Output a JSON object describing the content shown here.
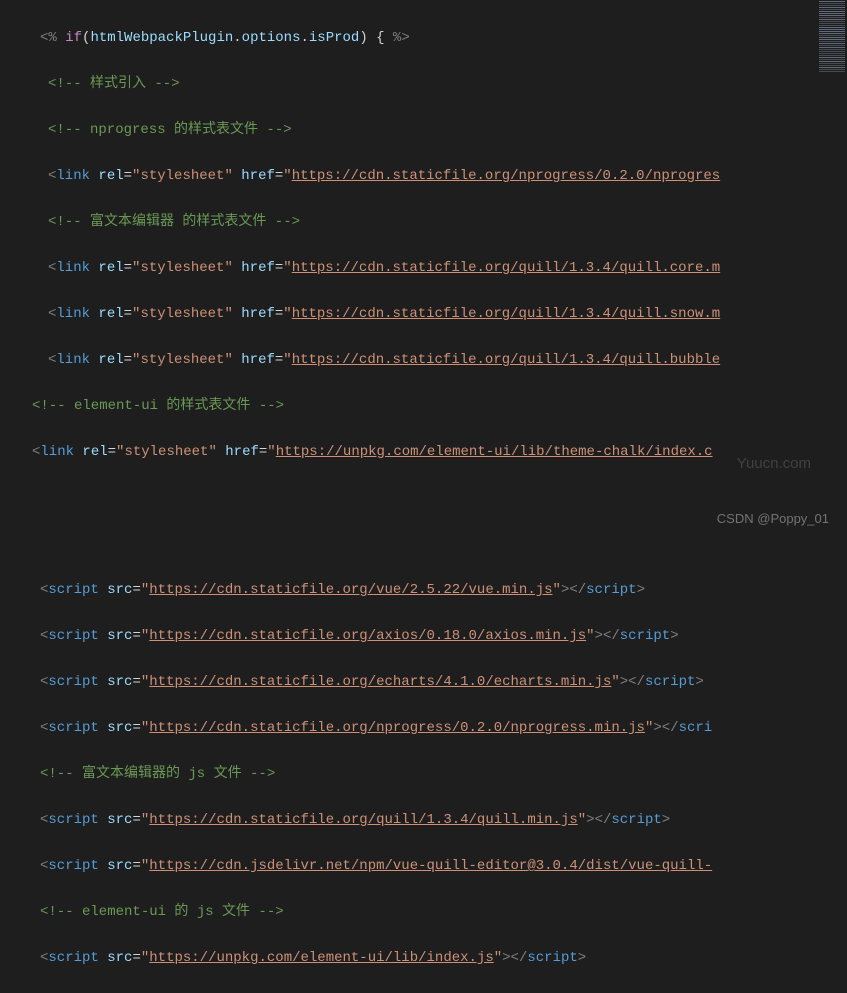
{
  "lines": {
    "l1a": "<%",
    "l1b": " if",
    "l1c": "(",
    "l1d": "htmlWebpackPlugin",
    "l1e": ".",
    "l1f": "options",
    "l1g": ".",
    "l1h": "isProd",
    "l1i": ") { ",
    "l1j": "%>",
    "c1": "<!-- 样式引入 -->",
    "c2": "<!-- nprogress 的样式表文件 -->",
    "rel": "rel",
    "href": "href",
    "src": "src",
    "eq": "=",
    "stylesheet": "\"stylesheet\"",
    "lt": "<",
    "gt": ">",
    "ltc": "</",
    "link": "link",
    "script": "script",
    "u1": "https://cdn.staticfile.org/nprogress/0.2.0/nprogres",
    "c3": "<!-- 富文本编辑器 的样式表文件 -->",
    "u2": "https://cdn.staticfile.org/quill/1.3.4/quill.core.m",
    "u3": "https://cdn.staticfile.org/quill/1.3.4/quill.snow.m",
    "u4": "https://cdn.staticfile.org/quill/1.3.4/quill.bubble",
    "c4": "<!-- element-ui 的样式表文件 -->",
    "u5": "https://unpkg.com/element-ui/lib/theme-chalk/index.c",
    "s1": "https://cdn.staticfile.org/vue/2.5.22/vue.min.js",
    "s2": "https://cdn.staticfile.org/axios/0.18.0/axios.min.js",
    "s3": "https://cdn.staticfile.org/echarts/4.1.0/echarts.min.js",
    "s4": "https://cdn.staticfile.org/nprogress/0.2.0/nprogress.min.js",
    "c5": "<!-- 富文本编辑器的 js 文件 -->",
    "s5": "https://cdn.staticfile.org/quill/1.3.4/quill.min.js",
    "s6": "https://cdn.jsdelivr.net/npm/vue-quill-editor@3.0.4/dist/vue-quill-",
    "c6": "<!-- element-ui 的 js 文件 -->",
    "s7": "https://unpkg.com/element-ui/lib/index.js",
    "scri": "scri",
    "q": "\""
  },
  "watermark": "Yuucn.com",
  "credit": "CSDN @Poppy_01"
}
